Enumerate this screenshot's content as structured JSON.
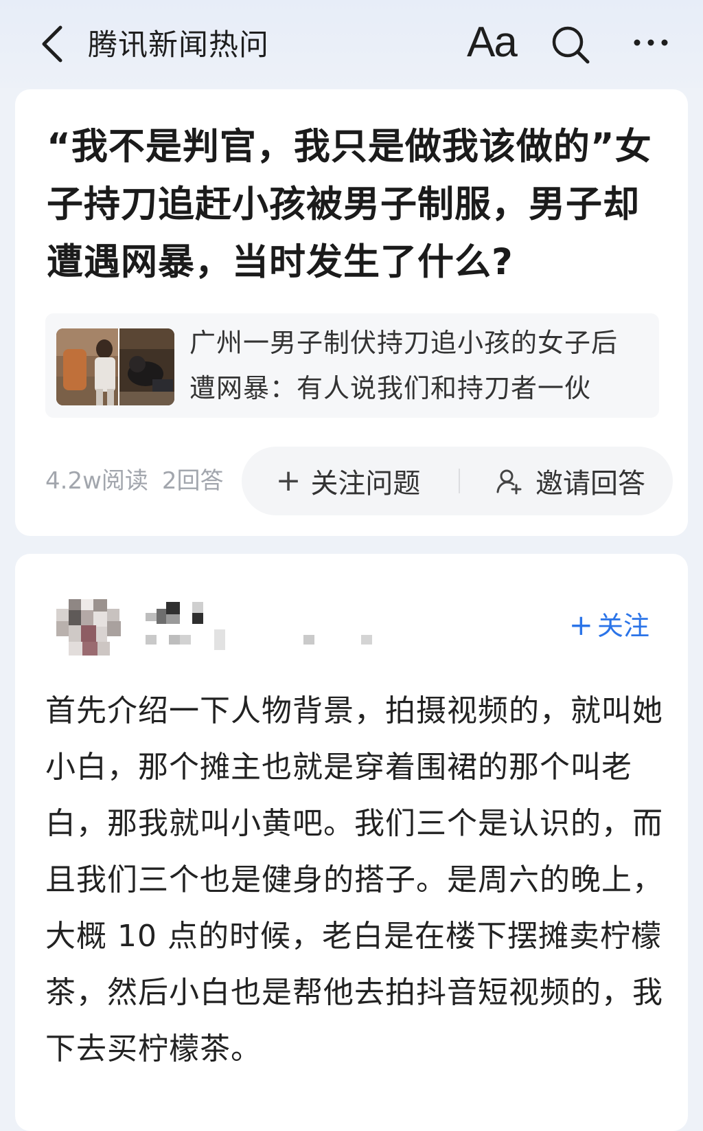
{
  "header": {
    "title": "腾讯新闻热问",
    "font_size_label": "Aa",
    "back_icon": "chevron-left-icon",
    "search_icon": "search-icon",
    "more_icon": "more-horizontal-icon"
  },
  "question": {
    "title": "“我不是判官，我只是做我该做的”女子持刀追赶小孩被男子制服，男子却遭遇网暴，当时发生了什么?",
    "related_news": {
      "title": "广州一男子制伏持刀追小孩的女子后遭网暴：有人说我们和持刀者一伙"
    },
    "stats": {
      "reads": "4.2w阅读",
      "answers": "2回答"
    },
    "follow_label": "关注问题",
    "invite_label": "邀请回答"
  },
  "answer": {
    "follow_label": "关注",
    "body": "首先介绍一下人物背景，拍摄视频的，就叫她小白，那个摊主也就是穿着围裙的那个叫老白，那我就叫小黄吧。我们三个是认识的，而且我们三个也是健身的搭子。是周六的晚上，大概 10 点的时候，老白是在楼下摆摊卖柠檬茶，然后小白也是帮他去拍抖音短视频的，我下去买柠檬茶。"
  },
  "colors": {
    "background": "#eef2f8",
    "card": "#ffffff",
    "accent": "#2b74e8",
    "muted": "#a2a6ad"
  }
}
